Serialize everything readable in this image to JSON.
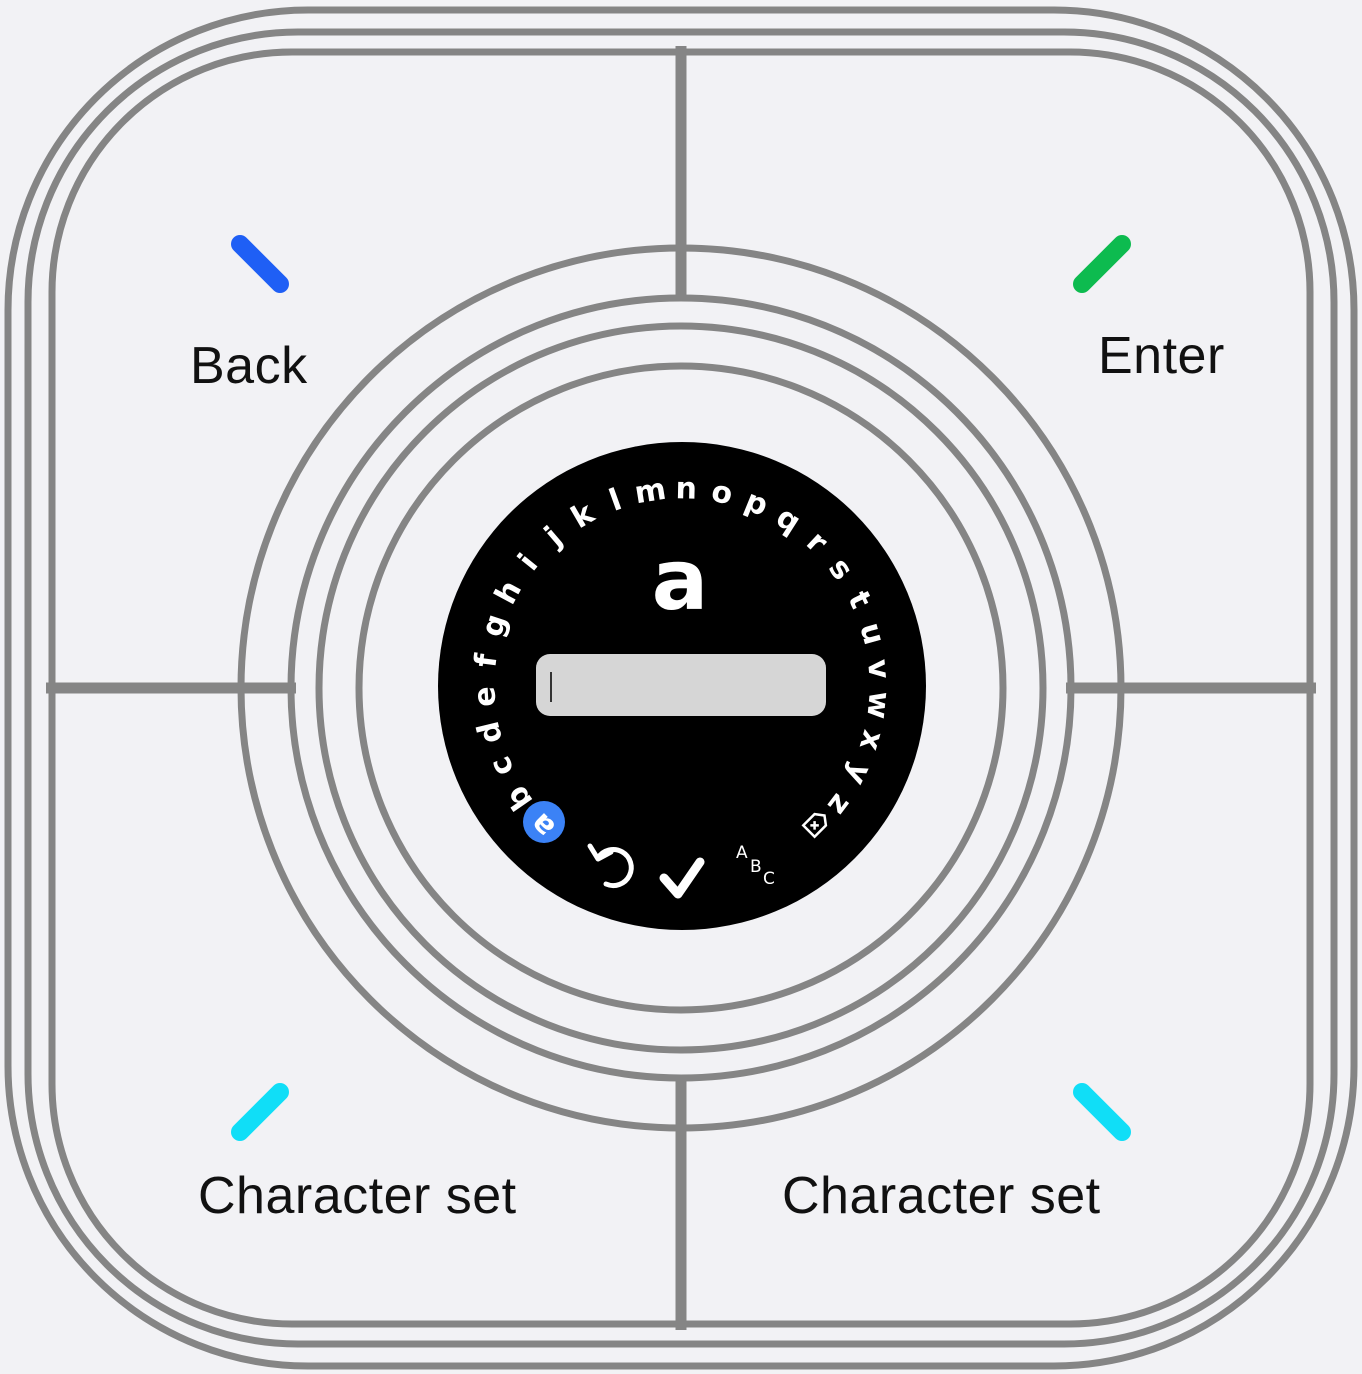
{
  "controller": {
    "back_label": "Back",
    "enter_label": "Enter",
    "charset_left_label": "Character set",
    "charset_right_label": "Character set",
    "colors": {
      "back_indicator": "#1f5ff5",
      "enter_indicator": "#0dbb4f",
      "charset_indicator": "#10def7",
      "outline": "#858585"
    }
  },
  "watch": {
    "current_letter": "a",
    "input_value": "",
    "letters": [
      "a",
      "b",
      "c",
      "d",
      "e",
      "f",
      "g",
      "h",
      "i",
      "j",
      "k",
      "l",
      "m",
      "n",
      "o",
      "p",
      "q",
      "r",
      "s",
      "t",
      "u",
      "v",
      "w",
      "x",
      "y",
      "z"
    ],
    "selected_letter": "a",
    "selected_color": "#3b82f6",
    "icons": {
      "undo": "undo-icon",
      "confirm": "check-icon",
      "case_toggle": "ABC",
      "delete": "delete-icon"
    }
  }
}
